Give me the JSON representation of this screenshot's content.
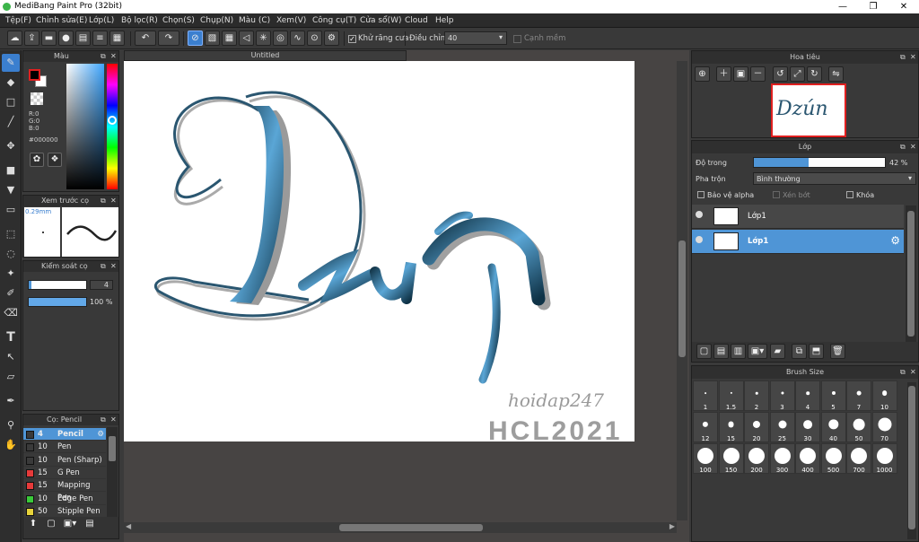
{
  "app": {
    "title": "MediBang Paint Pro (32bit)",
    "minimize": "—",
    "restore": "❐",
    "close": "✕"
  },
  "menu": [
    "Tệp(F)",
    "Chỉnh sửa(E)",
    "Lớp(L)",
    "Bộ lọc(R)",
    "Chọn(S)",
    "Chụp(N)",
    "Màu (C)",
    "Xem(V)",
    "Công cụ(T)",
    "Cửa sổ(W)",
    "Cloud",
    "Help"
  ],
  "toolbar": {
    "antialias": "Khử răng cưa",
    "adjust_label": "Điều chỉnh",
    "adjust_value": "40",
    "smooth": "Cạnh mềm"
  },
  "color_panel": {
    "title": "Màu",
    "r": "R:0",
    "g": "G:0",
    "b": "B:0",
    "hex": "#000000",
    "fg": "#000000",
    "bg": "#ffffff"
  },
  "brush_preview": {
    "title": "Xem trước cọ",
    "size": "0.29mm"
  },
  "brush_control": {
    "title": "Kiểm soát cọ",
    "size": "4",
    "opacity": "100 %",
    "size_fraction": 1,
    "opacity_fraction": 1
  },
  "brush_list": {
    "title": "Cọ: Pencil",
    "items": [
      {
        "num": "4",
        "name": "Pencil",
        "color": "#3a3a3a",
        "selected": true
      },
      {
        "num": "10",
        "name": "Pen",
        "color": "#3a3a3a"
      },
      {
        "num": "10",
        "name": "Pen (Sharp)",
        "color": "#3a3a3a"
      },
      {
        "num": "15",
        "name": "G Pen",
        "color": "#e63a3a"
      },
      {
        "num": "15",
        "name": "Mapping Pen",
        "color": "#e63a3a"
      },
      {
        "num": "10",
        "name": "Edge Pen",
        "color": "#3ac93a"
      },
      {
        "num": "50",
        "name": "Stipple Pen",
        "color": "#e6d23a"
      }
    ]
  },
  "document": {
    "tab": "Untitled",
    "artwork_text": "Dzún",
    "signature": "hoidap247",
    "watermark": "HCL2021"
  },
  "navigator": {
    "title": "Hoa tiêu"
  },
  "layers": {
    "title": "Lớp",
    "opacity_label": "Độ trong",
    "opacity_value": "42 %",
    "opacity_fraction": 0.42,
    "blend_label": "Pha trộn",
    "blend_value": "Bình thường",
    "protect_alpha": "Bảo vệ alpha",
    "clipping": "Xén bớt",
    "lock": "Khóa",
    "items": [
      {
        "name": "Lớp1",
        "selected": false
      },
      {
        "name": "Lớp1",
        "selected": true
      }
    ]
  },
  "brush_size": {
    "title": "Brush Size",
    "sizes": [
      "1",
      "1.5",
      "2",
      "3",
      "4",
      "5",
      "7",
      "10",
      "12",
      "15",
      "20",
      "25",
      "30",
      "40",
      "50",
      "70",
      "100",
      "150",
      "200",
      "300",
      "400",
      "500",
      "700",
      "1000"
    ]
  },
  "colors": {
    "accent": "#3b7fcf",
    "layer_selected": "#4f95d6",
    "panel": "#393939"
  }
}
